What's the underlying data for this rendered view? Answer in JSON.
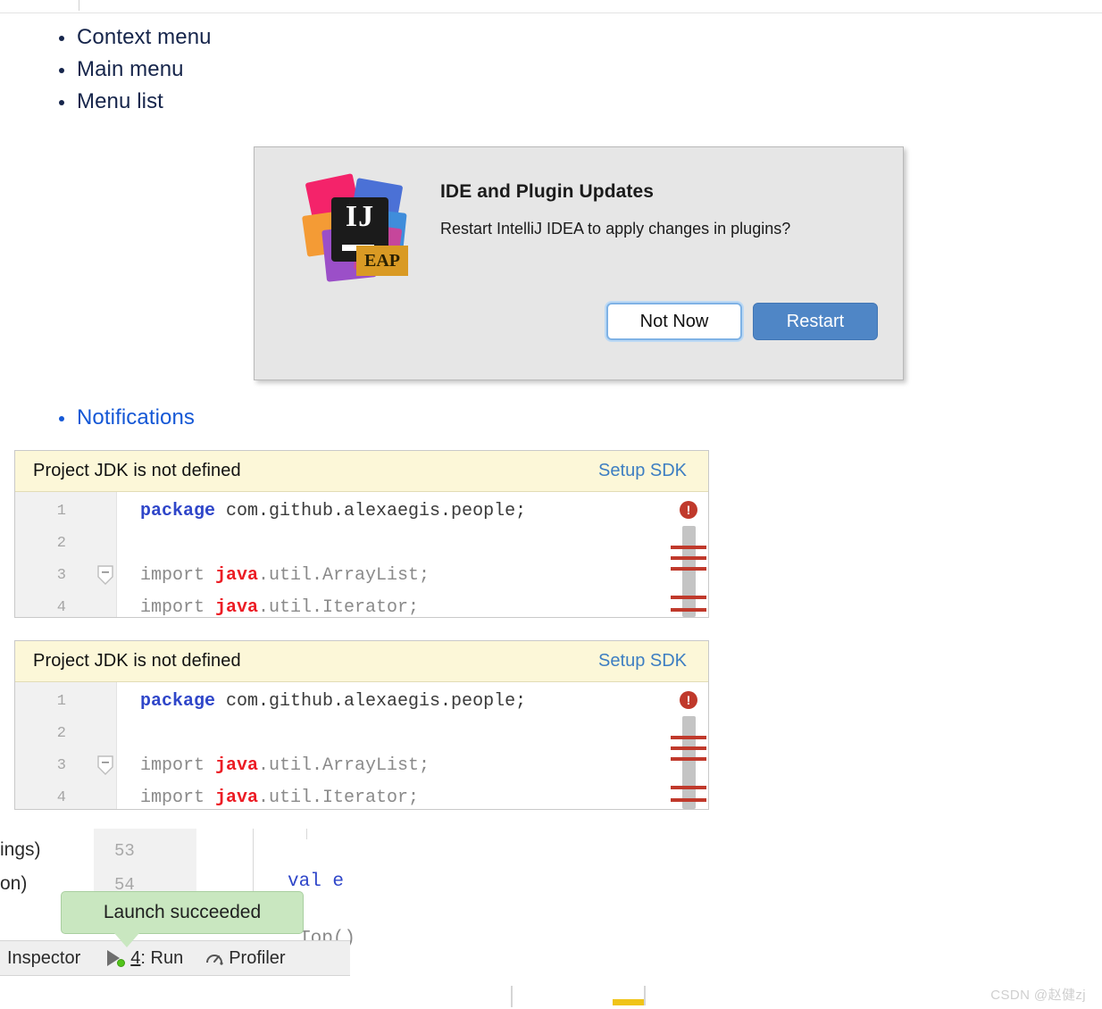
{
  "page": {
    "watermark": "CSDN @赵健zj"
  },
  "list_top": {
    "items": [
      {
        "label": "Context menu"
      },
      {
        "label": "Main menu"
      },
      {
        "label": "Menu list"
      }
    ]
  },
  "list_notifications": {
    "items": [
      {
        "label": "Notifications"
      }
    ]
  },
  "dialog": {
    "title": "IDE and Plugin Updates",
    "message": "Restart IntelliJ IDEA to apply changes in plugins?",
    "logo": {
      "monogram": "IJ",
      "badge": "EAP"
    },
    "buttons": {
      "secondary": "Not Now",
      "primary": "Restart"
    },
    "colors": {
      "background": "#e6e6e6",
      "primary_button": "#4f86c6",
      "focus_ring": "#bcd9f4",
      "badge": "#d99a24"
    }
  },
  "notification_panels": [
    {
      "banner_message": "Project JDK is not defined",
      "banner_action": "Setup SDK",
      "banner_color": "#fcf7d8",
      "link_color": "#3d7ec2",
      "error_badge": "!",
      "lines": [
        {
          "number": "1",
          "tokens": [
            {
              "text": "package",
              "style": "kw-blue"
            },
            {
              "text": " com.github.alexaegis.people;",
              "style": "plain-dark"
            }
          ]
        },
        {
          "number": "2",
          "tokens": []
        },
        {
          "number": "3",
          "fold": true,
          "tokens": [
            {
              "text": "import ",
              "style": "plain"
            },
            {
              "text": "java",
              "style": "kw-red"
            },
            {
              "text": ".util.ArrayList;",
              "style": "plain"
            }
          ]
        },
        {
          "number": "4",
          "tokens": [
            {
              "text": "import ",
              "style": "plain"
            },
            {
              "text": "java",
              "style": "kw-red"
            },
            {
              "text": ".util.Iterator;",
              "style": "plain"
            }
          ]
        }
      ]
    },
    {
      "banner_message": "Project JDK is not defined",
      "banner_action": "Setup SDK",
      "banner_color": "#fcf7d8",
      "link_color": "#3d7ec2",
      "error_badge": "!",
      "lines": [
        {
          "number": "1",
          "tokens": [
            {
              "text": "package",
              "style": "kw-blue"
            },
            {
              "text": " com.github.alexaegis.people;",
              "style": "plain-dark"
            }
          ]
        },
        {
          "number": "2",
          "tokens": []
        },
        {
          "number": "3",
          "fold": true,
          "tokens": [
            {
              "text": "import ",
              "style": "plain"
            },
            {
              "text": "java",
              "style": "kw-red"
            },
            {
              "text": ".util.ArrayList;",
              "style": "plain"
            }
          ]
        },
        {
          "number": "4",
          "tokens": [
            {
              "text": "import ",
              "style": "plain"
            },
            {
              "text": "java",
              "style": "kw-red"
            },
            {
              "text": ".util.Iterator;",
              "style": "plain"
            }
          ]
        }
      ]
    }
  ],
  "ide_fragment": {
    "left_text_lines": [
      "ings)",
      "on)"
    ],
    "gutter_numbers": [
      "53",
      "54"
    ],
    "code_snippets": [
      {
        "blue": "val",
        "gray": " e"
      },
      {
        "blue": "",
        "gray": "Top()"
      }
    ],
    "tooltip": "Launch succeeded",
    "tooltip_color": "#c9e7c0",
    "statusbar": {
      "inspector_label": "Inspector",
      "run_index": "4",
      "run_label": ": Run",
      "profiler_label": "Profiler"
    }
  }
}
